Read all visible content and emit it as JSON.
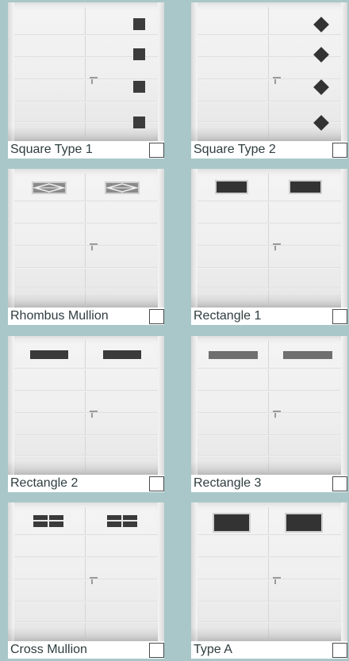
{
  "options": [
    {
      "label": "Square Type 1",
      "window_style": "square",
      "checked": false
    },
    {
      "label": "Square Type 2",
      "window_style": "diamond",
      "checked": false
    },
    {
      "label": "Rhombus Mullion",
      "window_style": "rhombus-mullion",
      "checked": false
    },
    {
      "label": "Rectangle 1",
      "window_style": "rectangle-1",
      "checked": false
    },
    {
      "label": "Rectangle 2",
      "window_style": "rectangle-2",
      "checked": false
    },
    {
      "label": "Rectangle 3",
      "window_style": "rectangle-3",
      "checked": false
    },
    {
      "label": "Cross Mullion",
      "window_style": "cross-mullion",
      "checked": false
    },
    {
      "label": "Type A",
      "window_style": "type-a",
      "checked": false
    }
  ],
  "colors": {
    "background": "#a9c7c9",
    "label_text": "#2f3d3f",
    "window_dark": "#3a3a3a"
  }
}
